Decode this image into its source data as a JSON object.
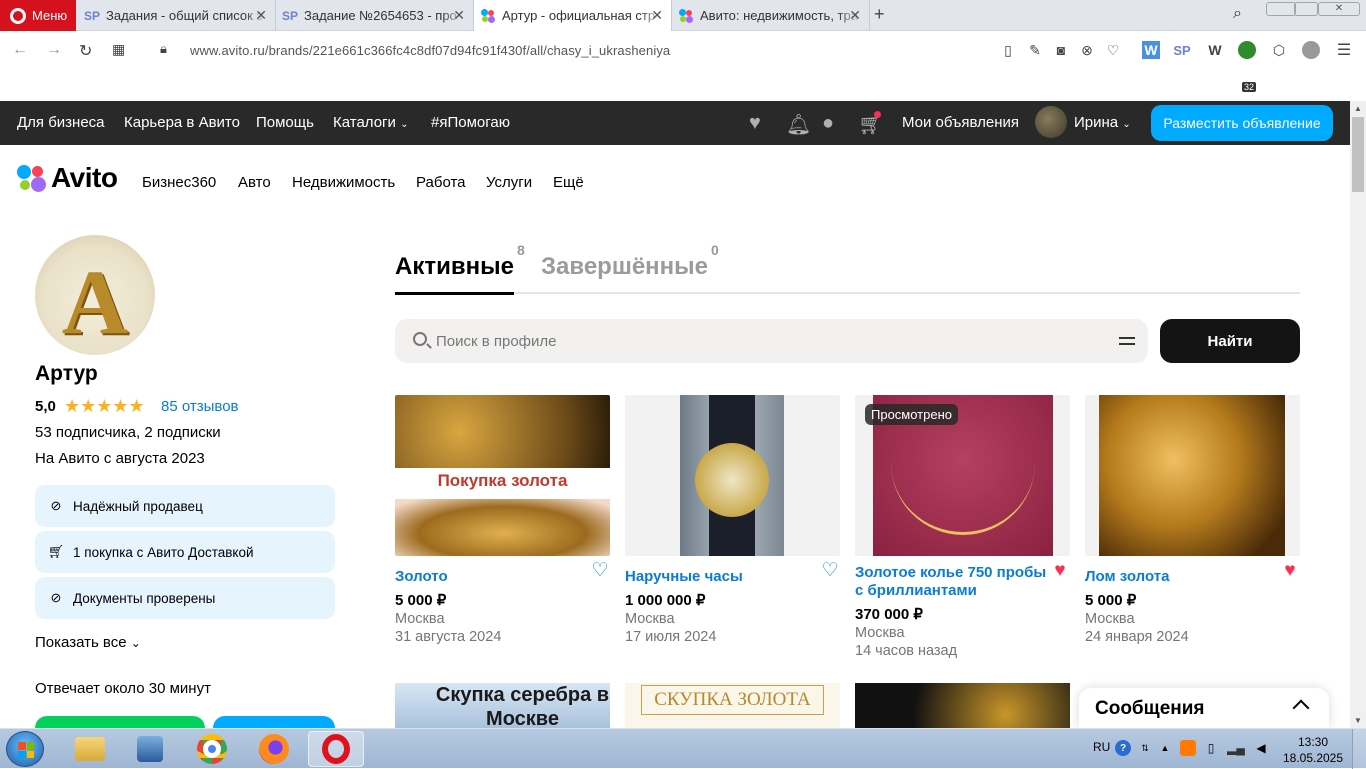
{
  "browser": {
    "menu_label": "Меню",
    "tabs": [
      {
        "title": "Задания - общий список з",
        "icon": "sp-icon"
      },
      {
        "title": "Задание №2654653 - про",
        "icon": "sp-icon"
      },
      {
        "title": "Артур - официальная стр",
        "icon": "avito-icon",
        "active": true
      },
      {
        "title": "Авито: недвижимость, тра",
        "icon": "avito-icon"
      }
    ],
    "url": "www.avito.ru/brands/221e661c366fc4c8df07d94fc91f430f/all/chasy_i_ukrasheniya",
    "ext_badge": "32"
  },
  "topnav": {
    "items": [
      "Для бизнеса",
      "Карьера в Авито",
      "Помощь",
      "Каталоги",
      "#яПомогаю"
    ],
    "my_ads": "Мои объявления",
    "user_name": "Ирина",
    "post_button": "Разместить объявление"
  },
  "logo_text": "Avito",
  "categories": [
    "Бизнес360",
    "Авто",
    "Недвижимость",
    "Работа",
    "Услуги",
    "Ещё"
  ],
  "profile": {
    "avatar_letter": "A",
    "name": "Артур",
    "rating": "5,0",
    "stars": 5,
    "reviews": "85 отзывов",
    "followers": "53 подписчика, 2 подписки",
    "since": "На Авито с августа 2023",
    "badges": [
      {
        "icon": "check-circle-icon",
        "label": "Надёжный продавец"
      },
      {
        "icon": "cart-icon",
        "label": "1 покупка с Авито Доставкой"
      },
      {
        "icon": "check-circle-icon",
        "label": "Документы проверены"
      }
    ],
    "show_all": "Показать все",
    "response_time": "Отвечает около 30 минут"
  },
  "listing_tabs": {
    "active_label": "Активные",
    "active_count": "8",
    "done_label": "Завершённые",
    "done_count": "0"
  },
  "search": {
    "placeholder": "Поиск в профиле",
    "button": "Найти"
  },
  "items": [
    {
      "title": "Золото",
      "price": "5 000 ₽",
      "city": "Москва",
      "date": "31 августа 2024",
      "favorite": false,
      "image_text": "Покупка золота"
    },
    {
      "title": "Наручные часы",
      "price": "1 000 000 ₽",
      "city": "Москва",
      "date": "17 июля 2024",
      "favorite": false
    },
    {
      "title": "Золотое колье 750 пробы с бриллиантами",
      "price": "370 000 ₽",
      "city": "Москва",
      "date": "14 часов назад",
      "favorite": true,
      "viewed_label": "Просмотрено"
    },
    {
      "title": "Лом золота",
      "price": "5 000 ₽",
      "city": "Москва",
      "date": "24 января 2024",
      "favorite": true
    }
  ],
  "second_row": [
    "Скупка серебра в Москве",
    "СКУПКА ЗОЛОТА"
  ],
  "messages_title": "Сообщения",
  "taskbar": {
    "lang": "RU",
    "time": "13:30",
    "date": "18.05.2025"
  },
  "colors": {
    "accent_blue": "#00aaff",
    "link_blue": "#0a7cd5",
    "dark_nav": "#292929",
    "favorite_red": "#ff2d55"
  }
}
